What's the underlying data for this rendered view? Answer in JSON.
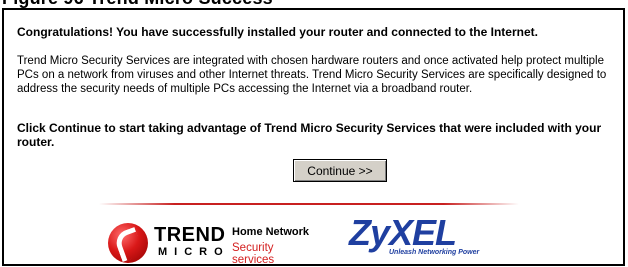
{
  "page": {
    "title": "Figure 96 Trend Micro Success"
  },
  "content": {
    "congrats": "Congratulations! You have successfully installed your router and connected to the Internet.",
    "description": "Trend Micro Security Services are integrated with chosen hardware routers and once activated help protect multiple PCs on a network from viruses and other Internet threats. Trend Micro Security Services are specifically designed to address the security needs of multiple PCs accessing the Internet via a broadband router.",
    "cta": "Click Continue to start taking advantage of Trend Micro Security Services that were included with your router.",
    "continue_label": "Continue >>"
  },
  "branding": {
    "trend_word": "TREND",
    "micro_word": "MICRO",
    "home_network": "Home Network",
    "security_services": "Security services",
    "zyxel_word": "ZyXEL",
    "zyxel_tagline": "Unleash Networking Power",
    "trend_red": "#d91818",
    "zyxel_blue": "#1f3fa0"
  }
}
